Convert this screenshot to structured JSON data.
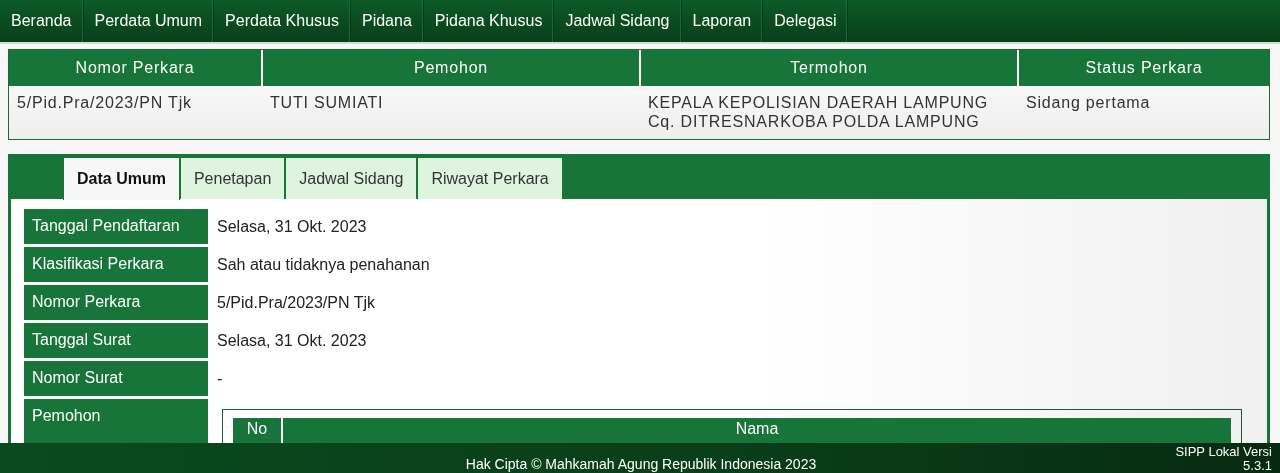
{
  "nav": {
    "items": [
      {
        "label": "Beranda"
      },
      {
        "label": "Perdata Umum"
      },
      {
        "label": "Perdata Khusus"
      },
      {
        "label": "Pidana"
      },
      {
        "label": "Pidana Khusus"
      },
      {
        "label": "Jadwal Sidang"
      },
      {
        "label": "Laporan"
      },
      {
        "label": "Delegasi"
      }
    ]
  },
  "case_table": {
    "columns": [
      "Nomor Perkara",
      "Pemohon",
      "Termohon",
      "Status Perkara"
    ],
    "rows": [
      [
        "5/Pid.Pra/2023/PN Tjk",
        "TUTI SUMIATI",
        "KEPALA KEPOLISIAN DAERAH LAMPUNG\nCq. DITRESNARKOBA POLDA LAMPUNG",
        "Sidang pertama"
      ]
    ]
  },
  "detail": {
    "tabs": [
      {
        "label": "Data Umum",
        "selected": true
      },
      {
        "label": "Penetapan",
        "selected": false
      },
      {
        "label": "Jadwal Sidang",
        "selected": false
      },
      {
        "label": "Riwayat Perkara",
        "selected": false
      }
    ],
    "fields": [
      {
        "label": "Tanggal Pendaftaran",
        "value": "Selasa, 31 Okt. 2023"
      },
      {
        "label": "Klasifikasi Perkara",
        "value": "Sah atau tidaknya penahanan"
      },
      {
        "label": "Nomor Perkara",
        "value": "5/Pid.Pra/2023/PN Tjk"
      },
      {
        "label": "Tanggal Surat",
        "value": "Selasa, 31 Okt. 2023"
      },
      {
        "label": "Nomor Surat",
        "value": "-"
      },
      {
        "label": "Pemohon",
        "table": {
          "columns": [
            "No",
            "Nama"
          ]
        }
      }
    ]
  },
  "footer": {
    "copyright": "Hak Cipta © Mahkamah Agung Republik Indonesia 2023",
    "version": "SIPP Lokal Versi 5.3.1"
  }
}
